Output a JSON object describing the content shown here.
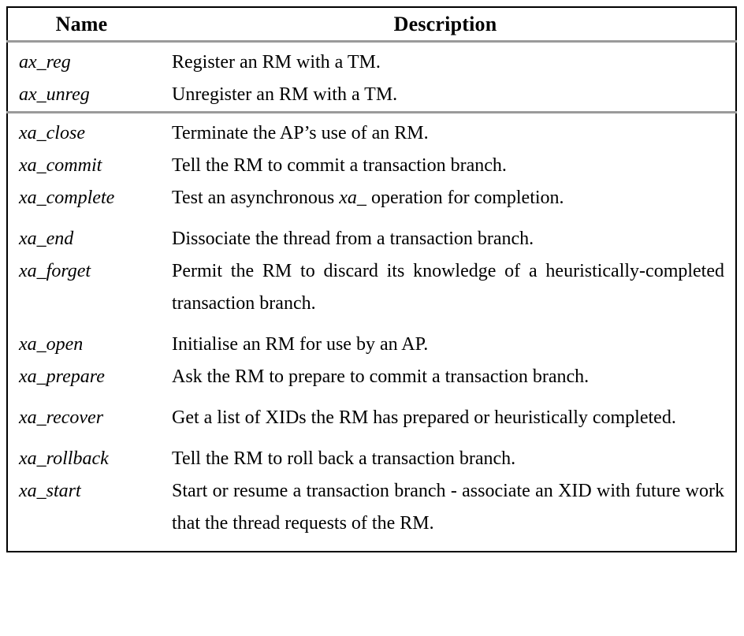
{
  "table": {
    "headers": {
      "name": "Name",
      "description": "Description"
    },
    "groups": [
      {
        "rows": [
          {
            "name": "ax_reg",
            "description": "Register an RM with a TM.",
            "lines": 1
          },
          {
            "name": "ax_unreg",
            "description": "Unregister an RM with a TM.",
            "lines": 1
          }
        ]
      },
      {
        "rows": [
          {
            "name": "xa_close",
            "description": "Terminate the AP’s use of an RM.",
            "lines": 1
          },
          {
            "name": "xa_commit",
            "description": "Tell the RM to commit a transaction branch.",
            "lines": 1
          },
          {
            "name": "xa_complete",
            "description": "Test an asynchronous xa_ operation for completion.",
            "description_html": "Test an asynchronous <i>xa_</i> operation for completion.",
            "lines": 2
          },
          {
            "name": "xa_end",
            "description": "Dissociate the thread from a transaction branch.",
            "lines": 1
          },
          {
            "name": "xa_forget",
            "description": "Permit the RM to discard its knowledge of a heuristically-completed transaction branch.",
            "lines": 2
          },
          {
            "name": "xa_open",
            "description": "Initialise an RM for use by an AP.",
            "lines": 1
          },
          {
            "name": "xa_prepare",
            "description": "Ask the RM to prepare to commit a transaction branch.",
            "lines": 2
          },
          {
            "name": "xa_recover",
            "description": "Get a list of XIDs the RM has prepared or heuristically completed.",
            "lines": 2
          },
          {
            "name": "xa_rollback",
            "description": "Tell the RM to roll back a transaction branch.",
            "lines": 1
          },
          {
            "name": "xa_start",
            "description": "Start or resume a transaction branch - associate an XID with future work that the thread requests of the RM.",
            "lines": 3
          }
        ]
      }
    ]
  }
}
